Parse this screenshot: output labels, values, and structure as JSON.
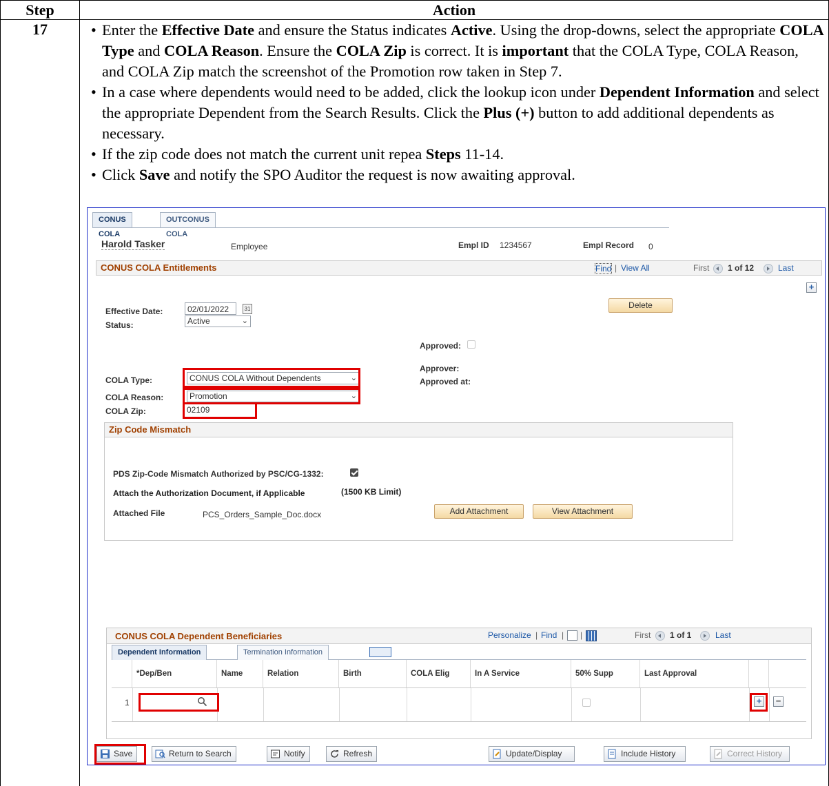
{
  "table": {
    "header_step": "Step",
    "header_action": "Action",
    "step_number": "17"
  },
  "bullets": {
    "b1_t1": "Enter the ",
    "b1_b1": "Effective Date",
    "b1_t2": " and ensure the Status indicates ",
    "b1_b2": "Active",
    "b1_t3": ".  Using the drop-downs, select the appropriate ",
    "b1_b3": "COLA Type",
    "b1_t4": " and ",
    "b1_b4": "COLA Reason",
    "b1_t5": ".  Ensure the ",
    "b1_b5": "COLA Zip",
    "b1_t6": " is correct.  It is ",
    "b1_b6": "important",
    "b1_t7": " that the COLA Type, COLA Reason, and COLA Zip match the screenshot of the Promotion row taken in Step 7.",
    "b2_t1": "In a case where dependents would need to be added, click the lookup icon under ",
    "b2_b1": "Dependent Information",
    "b2_t2": " and select the appropriate Dependent from the Search Results.  Click the ",
    "b2_b2": "Plus (+)",
    "b2_t3": " button to add additional dependents as necessary.",
    "b3_t1": "If the zip code does not match the current unit repea ",
    "b3_b1": "Steps",
    "b3_t2": " 11-14.",
    "b4_t1": "Click ",
    "b4_b1": "Save",
    "b4_t2": " and notify the SPO Auditor the request is now awaiting approval."
  },
  "screen": {
    "tabs": [
      "CONUS COLA",
      "OUTCONUS COLA"
    ],
    "employee_name": "Harold Tasker",
    "employee_label": "Employee",
    "empl_id_label": "Empl ID",
    "empl_id": "1234567",
    "empl_record_label": "Empl Record",
    "empl_record": "0",
    "entitlements_title": "CONUS COLA Entitlements",
    "nav": {
      "find": "Find",
      "view_all": "View All",
      "first": "First",
      "count": "1 of 12",
      "last": "Last"
    },
    "delete_label": "Delete",
    "effective_date_label": "Effective Date:",
    "effective_date": "02/01/2022",
    "status_label": "Status:",
    "status_value": "Active",
    "approved_label": "Approved:",
    "approver_label": "Approver:",
    "approved_at_label": "Approved at:",
    "cola_type_label": "COLA Type:",
    "cola_type_value": "CONUS COLA Without Dependents",
    "cola_reason_label": "COLA Reason:",
    "cola_reason_value": "Promotion",
    "cola_zip_label": "COLA Zip:",
    "cola_zip_value": "02109",
    "zip_mismatch_title": "Zip Code Mismatch",
    "pds_label": "PDS Zip-Code Mismatch Authorized by PSC/CG-1332:",
    "attach_label": "Attach the Authorization Document, if Applicable",
    "attach_limit": "(1500 KB Limit)",
    "attached_file_label": "Attached File",
    "attached_file_name": "PCS_Orders_Sample_Doc.docx",
    "add_attachment": "Add Attachment",
    "view_attachment": "View Attachment",
    "dep_title": "CONUS COLA Dependent Beneficiaries",
    "dep_nav": {
      "personalize": "Personalize",
      "find": "Find",
      "first": "First",
      "count": "1 of 1",
      "last": "Last"
    },
    "dep_tabs": [
      "Dependent Information",
      "Termination Information"
    ],
    "columns": [
      "*Dep/Ben",
      "Name",
      "Relation",
      "Birth",
      "COLA Elig",
      "In A Service",
      "50% Supp",
      "Last Approval"
    ],
    "row_number": "1",
    "toolbar": {
      "save": "Save",
      "return": "Return to Search",
      "notify": "Notify",
      "refresh": "Refresh",
      "update": "Update/Display",
      "include_history": "Include History",
      "correct_history": "Correct History"
    },
    "colors": {
      "highlight": "#e00000",
      "section_title": "#a04000",
      "link": "#1a56a6",
      "frame": "#1a2bc8"
    }
  }
}
